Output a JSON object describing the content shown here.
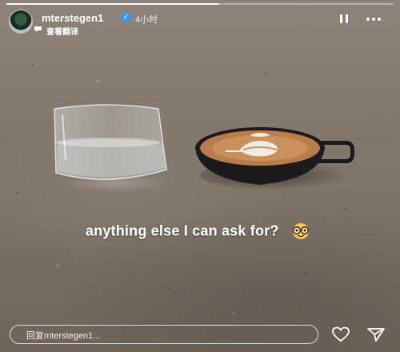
{
  "story": {
    "progress": 0.55,
    "username": "mterstegen1",
    "verified": true,
    "timestamp": "4小时",
    "translate_label": "查看翻译",
    "caption": "anything else I can ask for?",
    "caption_emoji": "nerd-face-emoji"
  },
  "icons": {
    "pause": "pause-icon",
    "more": "more-horizontal-icon",
    "translate": "speech-bubble-icon",
    "like": "heart-icon",
    "share": "paper-plane-icon"
  },
  "reply": {
    "placeholder": "回复mterstegen1..."
  },
  "colors": {
    "verified": "#3897f0",
    "cup": "#1b1b1d"
  }
}
